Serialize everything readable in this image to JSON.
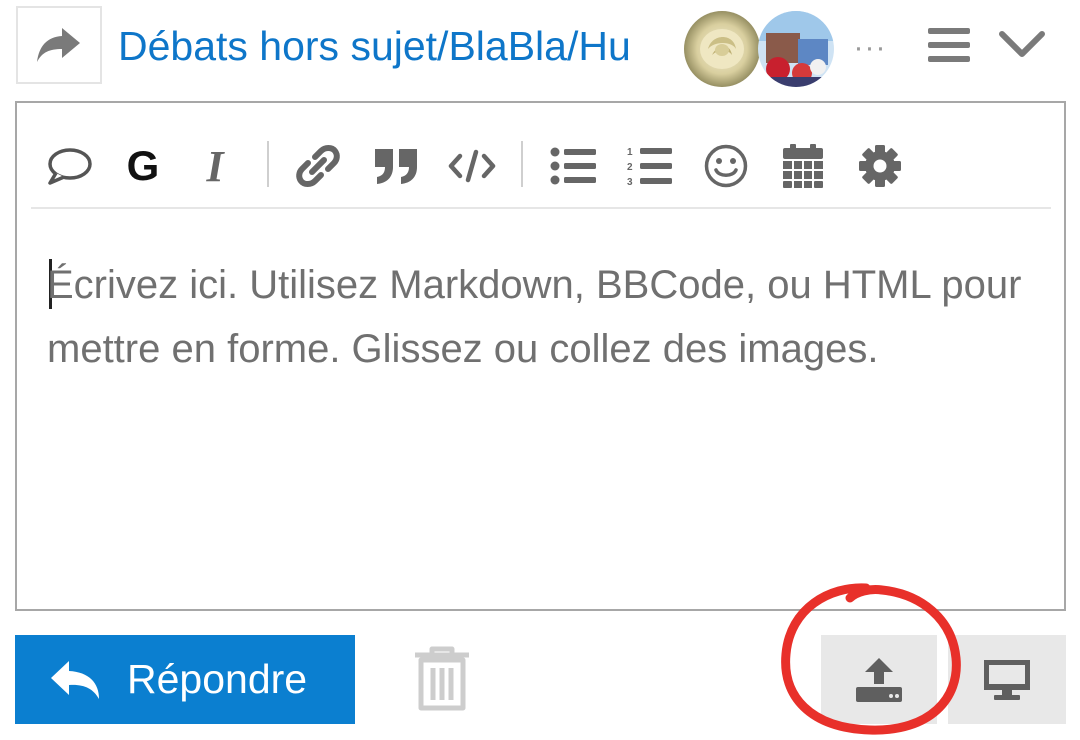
{
  "header": {
    "topic_title": "Débats hors sujet/BlaBla/Hu",
    "more_label": "···",
    "icons": {
      "reply": "share-arrow-icon",
      "menu": "hamburger-icon",
      "collapse": "chevron-down-icon"
    }
  },
  "toolbar": {
    "bold_label": "G",
    "italic_label": "I",
    "buttons": [
      "speech-bubble-icon",
      "bold-icon",
      "italic-icon",
      "link-icon",
      "quote-icon",
      "code-icon",
      "bullet-list-icon",
      "numbered-list-icon",
      "emoji-icon",
      "calendar-icon",
      "gear-icon"
    ]
  },
  "composer": {
    "placeholder": "Écrivez ici. Utilisez Markdown, BBCode, ou HTML pour mettre en forme. Glissez ou collez des images."
  },
  "footer": {
    "reply_label": "Répondre",
    "icons": {
      "delete": "trash-icon",
      "upload": "upload-icon",
      "preview": "monitor-icon"
    }
  },
  "colors": {
    "accent": "#0b7fd0",
    "title": "#0e76c9",
    "annotation": "#e8302a"
  }
}
